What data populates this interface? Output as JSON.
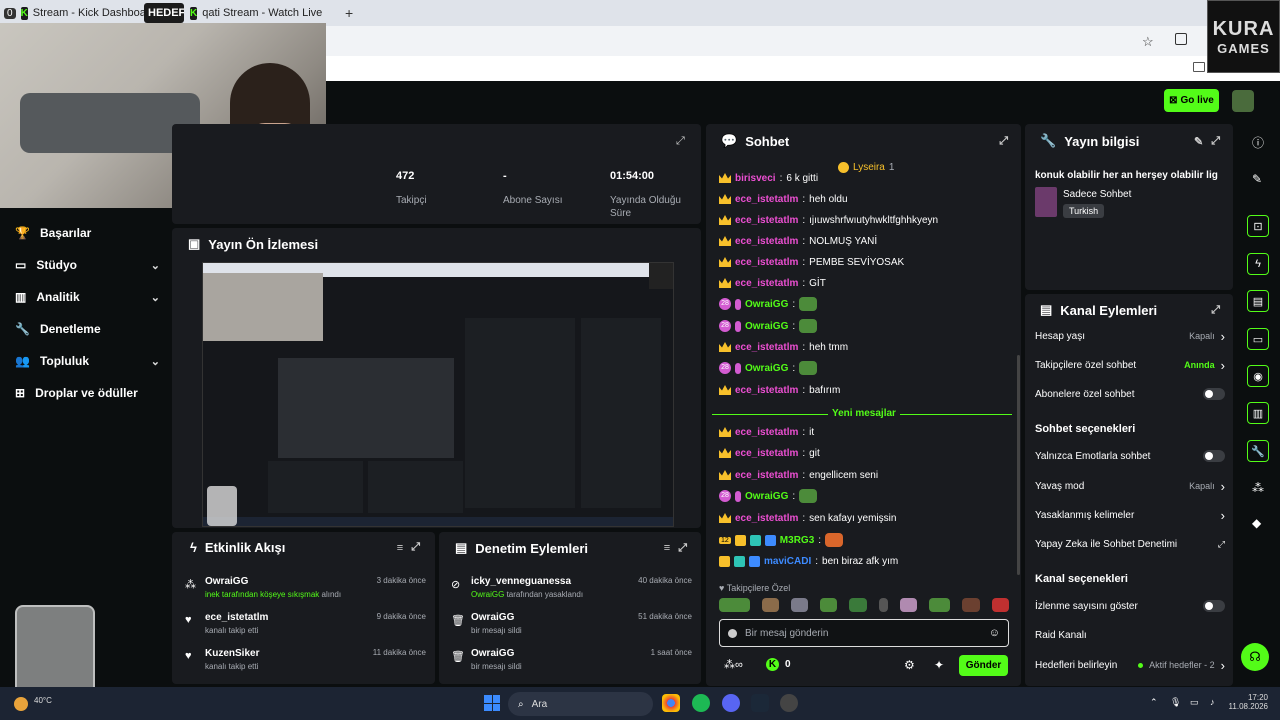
{
  "browser": {
    "tab1_count": "0",
    "tab1_title": "Stream - Kick Dashboard",
    "tab1_badge": "HEDEF",
    "tab2_title": "qati Stream - Watch Live o",
    "tab2_count": "5",
    "new_tab": "+",
    "close": "×"
  },
  "watermark": {
    "line1": "KURA",
    "line2": "GAMES"
  },
  "topbar": {
    "go_live": "Go live"
  },
  "sidebar": {
    "items": [
      {
        "label": "Başarılar",
        "chevron": false
      },
      {
        "label": "Stüdyo",
        "chevron": true
      },
      {
        "label": "Analitik",
        "chevron": true
      },
      {
        "label": "Denetleme",
        "chevron": false
      },
      {
        "label": "Topluluk",
        "chevron": true
      },
      {
        "label": "Droplar ve ödüller",
        "chevron": false
      }
    ]
  },
  "stats": [
    {
      "value": "472",
      "label": "Takipçi"
    },
    {
      "value": "-",
      "label": "Abone Sayısı"
    },
    {
      "value": "01:54:00",
      "label": "Yayında Olduğu Süre"
    }
  ],
  "preview": {
    "title": "Yayın Ön İzlemesi"
  },
  "activity": {
    "title": "Etkinlik Akışı",
    "items": [
      {
        "user": "OwraiGG",
        "highlight": "inek tarafından köşeye sıkışmak",
        "text": "alındı",
        "time": "3 dakika önce",
        "icon": "points-icon"
      },
      {
        "user": "ece_istetatlm",
        "highlight": "",
        "text": "kanalı takip etti",
        "time": "9 dakika önce",
        "icon": "heart-icon"
      },
      {
        "user": "KuzenSiker",
        "highlight": "",
        "text": "kanalı takip etti",
        "time": "11 dakika önce",
        "icon": "heart-icon"
      }
    ]
  },
  "moderation": {
    "title": "Denetim Eylemleri",
    "items": [
      {
        "user": "icky_venneguanessa",
        "highlight": "OwraiGG",
        "text": "tarafından yasaklandı",
        "time": "40 dakika önce",
        "icon": "ban-icon"
      },
      {
        "user": "OwraiGG",
        "highlight": "",
        "text": "bir mesajı sildi",
        "time": "51 dakika önce",
        "icon": "trash-icon"
      },
      {
        "user": "OwraiGG",
        "highlight": "",
        "text": "bir mesajı sildi",
        "time": "1 saat önce",
        "icon": "trash-icon"
      }
    ]
  },
  "chat": {
    "title": "Sohbet",
    "pinned_user": "Lyseira",
    "pinned_count": "1",
    "new_messages": "Yeni mesajlar",
    "messages": [
      {
        "user": "birisveci",
        "text": "6 k gitti",
        "color": "#ec4fd2"
      },
      {
        "user": "ece_istetatlm",
        "text": "heh oldu",
        "color": "#ec4fd2"
      },
      {
        "user": "ece_istetatlm",
        "text": "ıjıuwshrfwıutyhwkltfghhkyeyn",
        "color": "#ec4fd2"
      },
      {
        "user": "ece_istetatlm",
        "text": "NOLMUŞ YANİ",
        "color": "#ec4fd2"
      },
      {
        "user": "ece_istetatlm",
        "text": "PEMBE SEVİYOSAK",
        "color": "#ec4fd2"
      },
      {
        "user": "ece_istetatlm",
        "text": "GİT",
        "color": "#ec4fd2"
      },
      {
        "user": "OwraiGG",
        "text": "",
        "color": "#53fc18"
      },
      {
        "user": "OwraiGG",
        "text": "",
        "color": "#53fc18"
      },
      {
        "user": "ece_istetatlm",
        "text": "heh tmm",
        "color": "#ec4fd2"
      },
      {
        "user": "OwraiGG",
        "text": "",
        "color": "#53fc18"
      },
      {
        "user": "ece_istetatlm",
        "text": "bafırım",
        "color": "#ec4fd2"
      },
      {
        "user": "ece_istetatlm",
        "text": "it",
        "color": "#ec4fd2"
      },
      {
        "user": "ece_istetatlm",
        "text": "git",
        "color": "#ec4fd2"
      },
      {
        "user": "ece_istetatlm",
        "text": "engellicem seni",
        "color": "#ec4fd2"
      },
      {
        "user": "OwraiGG",
        "text": "",
        "color": "#53fc18"
      },
      {
        "user": "ece_istetatlm",
        "text": "sen kafayı yemişsin",
        "color": "#ec4fd2"
      },
      {
        "user": "M3RG3",
        "text": "",
        "color": "#53fc18"
      },
      {
        "user": "maviCADI",
        "text": "ben biraz afk yım",
        "color": "#3d8bff"
      }
    ],
    "emote_label": "Takipçilere Özel",
    "input_placeholder": "Bir mesaj gönderin",
    "points": "0",
    "send": "Gönder",
    "badge_12": "12",
    "badge_28": "28"
  },
  "stream_info": {
    "title": "Yayın bilgisi",
    "stream_title": "konuk olabilir her an herşey olabilir lig",
    "category": "Sadece Sohbet",
    "language": "Turkish"
  },
  "channel_actions": {
    "title": "Kanal Eylemleri",
    "rows_top": [
      {
        "label": "Hesap yaşı",
        "value": "Kapalı",
        "type": "chevron"
      },
      {
        "label": "Takipçilere özel sohbet",
        "value": "Anında",
        "type": "chevron-green"
      },
      {
        "label": "Abonelere özel sohbet",
        "value": "",
        "type": "toggle"
      }
    ],
    "chat_options_title": "Sohbet seçenekleri",
    "rows_chat": [
      {
        "label": "Yalnızca Emotlarla sohbet",
        "value": "",
        "type": "toggle"
      },
      {
        "label": "Yavaş mod",
        "value": "Kapalı",
        "type": "chevron"
      },
      {
        "label": "Yasaklanmış kelimeler",
        "value": "",
        "type": "chevron"
      },
      {
        "label": "Yapay Zeka ile Sohbet Denetimi",
        "value": "",
        "type": "external"
      }
    ],
    "channel_options_title": "Kanal seçenekleri",
    "rows_channel": [
      {
        "label": "İzlenme sayısını göster",
        "value": "",
        "type": "toggle"
      },
      {
        "label": "Raid Kanalı",
        "value": "",
        "type": "none"
      },
      {
        "label": "Hedefleri belirleyin",
        "value": "Aktif hedefler - 2",
        "type": "chevron"
      }
    ]
  },
  "taskbar": {
    "search": "Ara",
    "time": "17:20",
    "date": "11.08.2026",
    "weather": "40°C"
  }
}
